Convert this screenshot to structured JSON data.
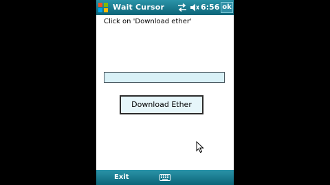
{
  "titlebar": {
    "app_title": "Wait Cursor",
    "clock": "6:56",
    "ok_label": "ok",
    "icons": [
      "windows-start-icon",
      "connectivity-icon",
      "volume-icon"
    ]
  },
  "content": {
    "instruction": "Click on 'Download ether'",
    "progress": {
      "value": 0
    },
    "download_button_label": "Download Ether",
    "cursor_icon": "mouse-pointer-icon"
  },
  "menubar": {
    "left_softkey": "Exit",
    "center_icon": "keyboard-icon"
  },
  "colors": {
    "bar": "#0c6578",
    "progress_bg": "#d9f1f7",
    "button_bg": "#e6f6fa",
    "screen_bg": "#ffffff",
    "letterbox": "#000000"
  }
}
